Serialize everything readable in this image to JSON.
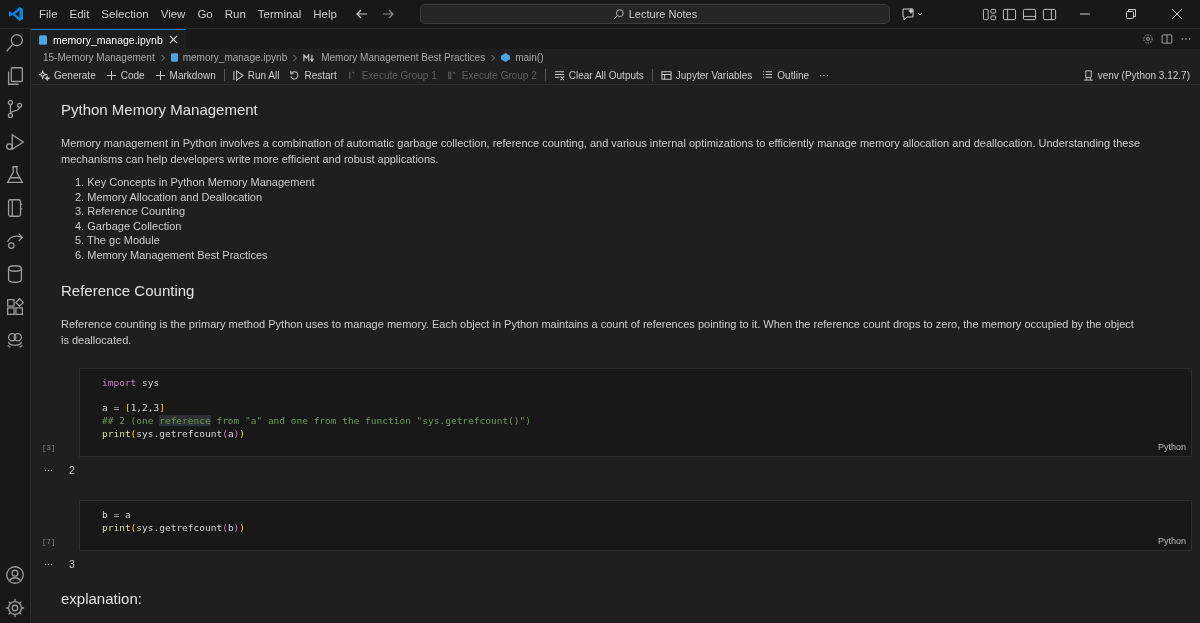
{
  "menu": [
    "File",
    "Edit",
    "Selection",
    "View",
    "Go",
    "Run",
    "Terminal",
    "Help"
  ],
  "search": {
    "value": "Lecture Notes"
  },
  "tabs": [
    {
      "label": "memory_manage.ipynb",
      "selected": true
    }
  ],
  "breadcrumbs": [
    {
      "kind": "folder",
      "label": "15-Memory Management"
    },
    {
      "kind": "file",
      "label": "memory_manage.ipynb"
    },
    {
      "kind": "markdown",
      "label": "Memory Management Best Practices"
    },
    {
      "kind": "symbol",
      "label": "main()"
    }
  ],
  "toolbar": [
    {
      "kind": "generate",
      "label": "Generate",
      "disabled": false
    },
    {
      "kind": "plus",
      "label": "Code",
      "disabled": false
    },
    {
      "kind": "plus",
      "label": "Markdown",
      "disabled": false
    },
    {
      "kind": "run",
      "label": "Run All",
      "disabled": false
    },
    {
      "kind": "restart",
      "label": "Restart",
      "disabled": false
    },
    {
      "kind": "group",
      "label": "Execute Group 1",
      "disabled": true
    },
    {
      "kind": "group2",
      "label": "Execute Group 2",
      "disabled": true
    },
    {
      "kind": "clear",
      "label": "Clear All Outputs",
      "disabled": false
    },
    {
      "kind": "variables",
      "label": "Jupyter Variables",
      "disabled": false
    },
    {
      "kind": "outline",
      "label": "Outline",
      "disabled": false
    }
  ],
  "toolbar_more": "···",
  "kernel": "venv (Python 3.12.7)",
  "cells": [
    {
      "kind": "markdown",
      "heading": "Python Memory Management",
      "paragraph": "Memory management in Python involves a combination of automatic garbage collection, reference counting, and various internal optimizations to efficiently manage memory allocation and deallocation. Understanding these mechanisms can help developers write more efficient and robust applications.",
      "list": [
        "1. Key Concepts in Python Memory Management",
        "2. Memory Allocation and Deallocation",
        "3. Reference Counting",
        "4. Garbage Collection",
        "5. The gc Module",
        "6. Memory Management Best Practices"
      ]
    },
    {
      "kind": "markdown",
      "heading": "Reference Counting",
      "paragraph": "Reference counting is the primary method Python uses to manage memory. Each object in Python maintains a count of references pointing to it. When the reference count drops to zero, the memory occupied by the object is deallocated."
    },
    {
      "kind": "code",
      "count": "[3]",
      "language": "Python",
      "output": "2",
      "blocks": [
        [
          [
            {
              "kind": "keyword",
              "text": "import"
            },
            {
              "kind": "plain",
              "text": " sys"
            }
          ]
        ],
        [
          [
            {
              "kind": "plain",
              "text": "a = "
            },
            {
              "kind": "bracket",
              "text": "["
            },
            {
              "kind": "plain",
              "text": "1,2,3"
            },
            {
              "kind": "bracket",
              "text": "]"
            }
          ],
          [
            {
              "kind": "comment",
              "text": "## 2 (one "
            },
            {
              "kind": "match",
              "text": "reference"
            },
            {
              "kind": "comment",
              "text": " from \"a\" and one from the function \"sys.getrefcount()\")"
            }
          ],
          [
            {
              "kind": "func",
              "text": "print"
            },
            {
              "kind": "bracket",
              "text": "("
            },
            {
              "kind": "plain",
              "text": "sys.getrefcount"
            },
            {
              "kind": "bracket2",
              "text": "("
            },
            {
              "kind": "plain",
              "text": "a"
            },
            {
              "kind": "bracket2",
              "text": ")"
            },
            {
              "kind": "bracket",
              "text": ")"
            }
          ]
        ]
      ]
    },
    {
      "kind": "code",
      "count": "[7]",
      "language": "Python",
      "output": "3",
      "blocks": [
        [
          [
            {
              "kind": "plain",
              "text": "b = a"
            }
          ],
          [
            {
              "kind": "func",
              "text": "print"
            },
            {
              "kind": "bracket",
              "text": "("
            },
            {
              "kind": "plain",
              "text": "sys.getrefcount"
            },
            {
              "kind": "bracket2",
              "text": "("
            },
            {
              "kind": "plain",
              "text": "b"
            },
            {
              "kind": "bracket2",
              "text": ")"
            },
            {
              "kind": "bracket",
              "text": ")"
            }
          ]
        ]
      ]
    },
    {
      "kind": "markdown",
      "heading": "explanation:"
    }
  ]
}
